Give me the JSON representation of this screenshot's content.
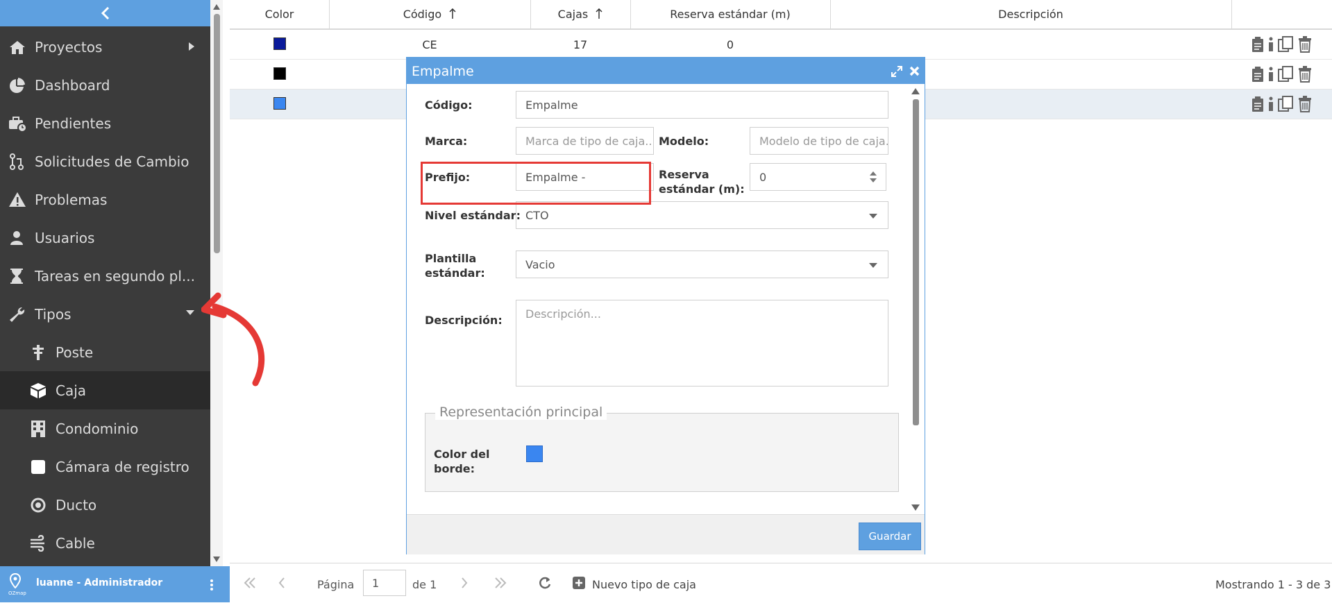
{
  "sidebar": {
    "items": [
      {
        "label": "Proyectos",
        "icon": "home-icon"
      },
      {
        "label": "Dashboard",
        "icon": "pie-chart-icon"
      },
      {
        "label": "Pendientes",
        "icon": "briefcase-clock-icon"
      },
      {
        "label": "Solicitudes de Cambio",
        "icon": "pull-request-icon"
      },
      {
        "label": "Problemas",
        "icon": "warning-icon"
      },
      {
        "label": "Usuarios",
        "icon": "user-icon"
      },
      {
        "label": "Tareas en segundo pl...",
        "icon": "hourglass-icon"
      },
      {
        "label": "Tipos",
        "icon": "wrench-icon"
      }
    ],
    "sub_items": [
      {
        "label": "Poste",
        "icon": "pole-icon"
      },
      {
        "label": "Caja",
        "icon": "box-icon"
      },
      {
        "label": "Condominio",
        "icon": "building-icon"
      },
      {
        "label": "Cámara de registro",
        "icon": "square-icon"
      },
      {
        "label": "Ducto",
        "icon": "circle-dot-icon"
      },
      {
        "label": "Cable",
        "icon": "cable-icon"
      }
    ],
    "user": "luanne - Administrador",
    "brand": "OZmap"
  },
  "table": {
    "headers": [
      "Color",
      "Código",
      "Cajas",
      "Reserva estándar (m)",
      "Descripción"
    ],
    "rows": [
      {
        "color": "#0a1a9a",
        "code": "CE",
        "boxes": "17",
        "reserve": "0"
      },
      {
        "color": "#000000",
        "code": "",
        "boxes": "",
        "reserve": ""
      },
      {
        "color": "#3a86f0",
        "code": "",
        "boxes": "",
        "reserve": ""
      }
    ]
  },
  "pager": {
    "page_label": "Página",
    "page_value": "1",
    "of_label": "de 1",
    "new_label": "Nuevo tipo de caja",
    "showing": "Mostrando 1 - 3 de 3"
  },
  "dialog": {
    "title": "Empalme",
    "code_label": "Código:",
    "code_value": "Empalme",
    "brand_label": "Marca:",
    "brand_placeholder": "Marca de tipo de caja...",
    "model_label": "Modelo:",
    "model_placeholder": "Modelo de tipo de caja...",
    "prefix_label": "Prefijo:",
    "prefix_value": "Empalme -",
    "reserve_label_1": "Reserva",
    "reserve_label_2": "estándar (m):",
    "reserve_value": "0",
    "level_label": "Nivel estándar:",
    "level_value": "CTO",
    "template_label_1": "Plantilla",
    "template_label_2": "estándar:",
    "template_value": "Vacio",
    "desc_label": "Descripción:",
    "desc_placeholder": "Descripción...",
    "legend": "Representación principal",
    "border_color_label_1": "Color del",
    "border_color_label_2": "borde:",
    "border_color": "#3a86f0",
    "save_label": "Guardar"
  },
  "colors": {
    "accent": "#5ea0e0",
    "sidebar_bg": "#3b3b3b",
    "annotation": "#e53935"
  }
}
